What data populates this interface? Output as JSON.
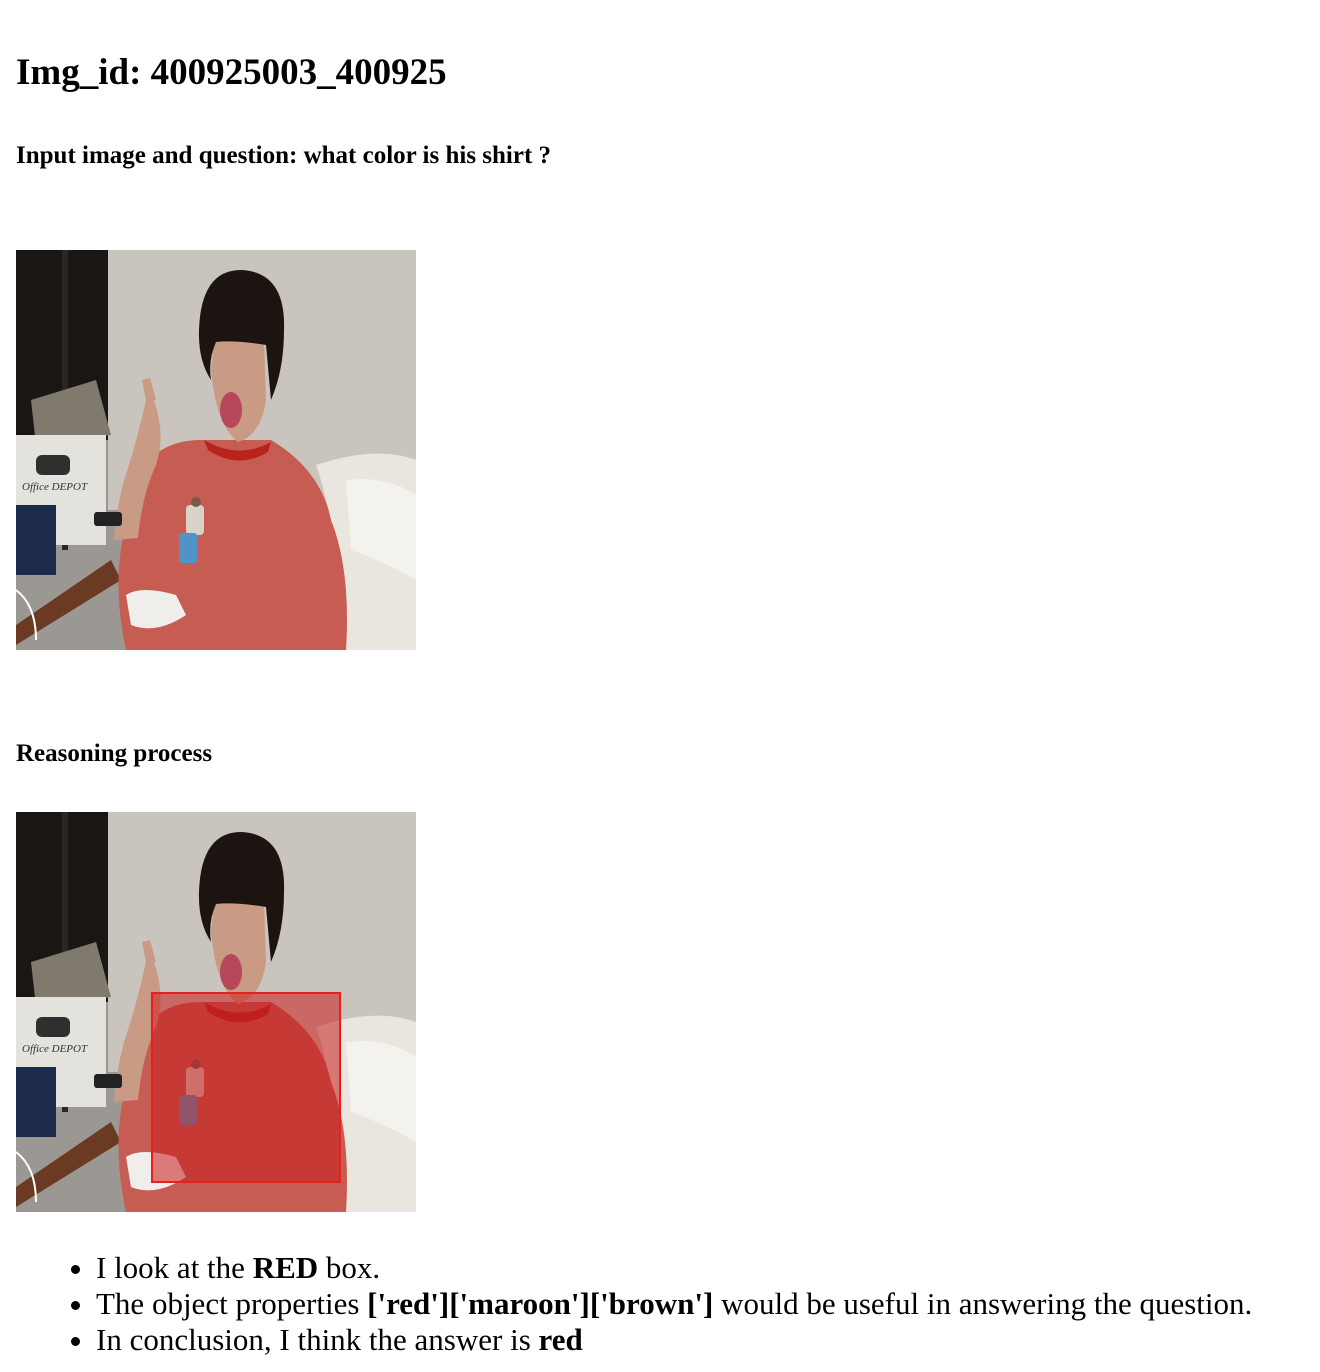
{
  "page": {
    "title": "Img_id: 400925003_400925",
    "question_heading": "Input image and question: what color is his shirt ?",
    "reasoning_heading": "Reasoning process"
  },
  "images": {
    "input_photo": "photo-of-man-in-red-tshirt",
    "reasoning_photo": "photo-of-man-in-red-tshirt-with-red-box",
    "box_color": "#e8201c"
  },
  "steps": [
    {
      "pre": "I look at the ",
      "bold": "RED",
      "post": " box."
    },
    {
      "pre": "The object properties ",
      "bold": "['red']['maroon']['brown']",
      "post": " would be useful in answering the question."
    },
    {
      "pre": "In conclusion, I think the answer is ",
      "bold": "red",
      "post": ""
    }
  ]
}
